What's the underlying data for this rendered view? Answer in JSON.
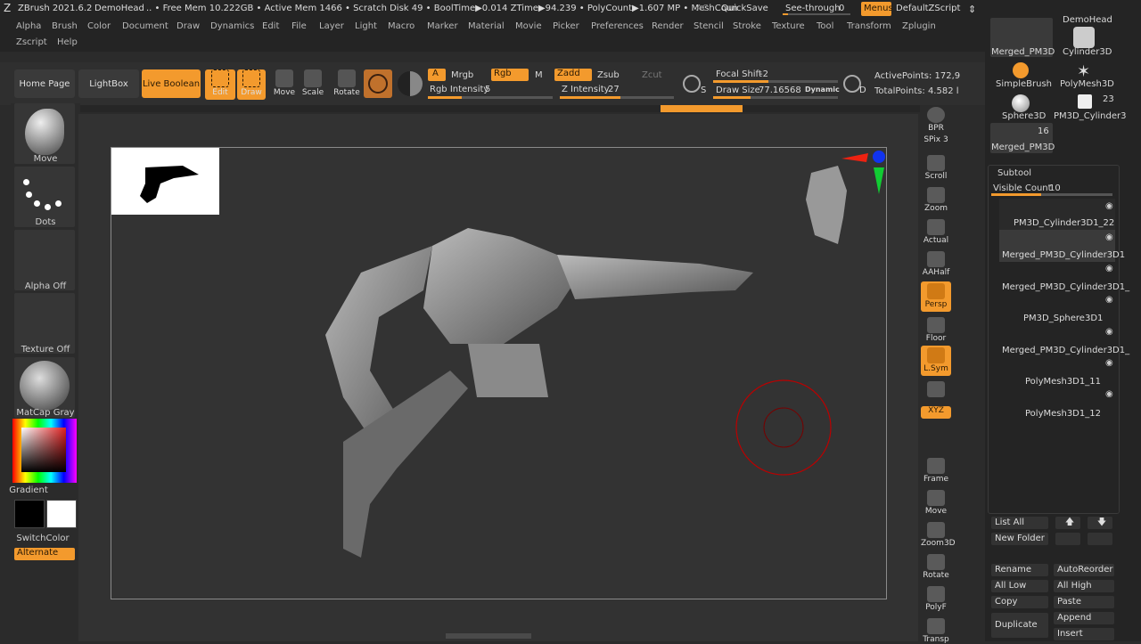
{
  "titlebar": {
    "app": "ZBrush 2021.6.2",
    "project": "DemoHead",
    "stats": ".. • Free Mem 10.222GB • Active Mem 1466 • Scratch Disk 49 • BoolTime▶0.014 ZTime▶94.239 • PolyCount▶1.607 MP • MeshCoun",
    "ac": "AC",
    "quicksave": "QuickSave",
    "seethrough_label": "See-through",
    "seethrough_value": "0",
    "menus": "Menus",
    "script": "DefaultZScript"
  },
  "menu": {
    "row1": [
      "Alpha",
      "Brush",
      "Color",
      "Document",
      "Draw",
      "Dynamics",
      "Edit",
      "File",
      "Layer",
      "Light",
      "Macro",
      "Marker",
      "Material",
      "Movie",
      "Picker",
      "Preferences",
      "Render",
      "Stencil",
      "Stroke",
      "Texture",
      "Tool",
      "Transform",
      "Zplugin"
    ],
    "row2": [
      "Zscript",
      "Help"
    ]
  },
  "toolbar": {
    "home": "Home Page",
    "lightbox": "LightBox",
    "liveboolean": "Live Boolean",
    "edit": "Edit",
    "draw": "Draw",
    "move": "Move",
    "scale": "Scale",
    "rotate": "Rotate",
    "a": "A",
    "mrgb": "Mrgb",
    "rgb": "Rgb",
    "m": "M",
    "zadd": "Zadd",
    "zsub": "Zsub",
    "zcut": "Zcut",
    "rgb_intensity_label": "Rgb Intensity",
    "rgb_intensity": "5",
    "z_intensity_label": "Z Intensity",
    "z_intensity": "27",
    "focal_label": "Focal Shift",
    "focal": "-2",
    "drawsize_label": "Draw Size",
    "drawsize": "77.16568",
    "dynamic": "Dynamic",
    "s": "S",
    "d": "D",
    "active_points": "ActivePoints: 172,9",
    "total_points": "TotalPoints: 4.582 l"
  },
  "left": {
    "move": "Move",
    "dots": "Dots",
    "alpha": "Alpha Off",
    "texture": "Texture Off",
    "matcap": "MatCap Gray",
    "gradient": "Gradient",
    "switchcolor": "SwitchColor",
    "alternate": "Alternate"
  },
  "right": [
    "BPR",
    "SPix 3",
    "Scroll",
    "Zoom",
    "Actual",
    "AAHalf",
    "Persp",
    "Floor",
    "L.Sym",
    "",
    "XYZ",
    "",
    "",
    "Frame",
    "Move",
    "Zoom3D",
    "Rotate",
    "PolyF",
    "Transp"
  ],
  "tools": [
    {
      "name": "Merged_PM3D"
    },
    {
      "name": "Cylinder3D"
    },
    {
      "name": "SimpleBrush"
    },
    {
      "name": "PolyMesh3D"
    },
    {
      "name": "Sphere3D"
    },
    {
      "name": "PM3D_Cylinder3"
    }
  ],
  "tool_counts": {
    "c1": "23",
    "c2": "16"
  },
  "tool_header": "DemoHead",
  "subtool": {
    "title": "Subtool",
    "visible_label": "Visible Count",
    "visible_value": "10",
    "items": [
      "PM3D_Cylinder3D1_22",
      "Merged_PM3D_Cylinder3D1",
      "Merged_PM3D_Cylinder3D1_",
      "PM3D_Sphere3D1",
      "Merged_PM3D_Cylinder3D1_",
      "PolyMesh3D1_11",
      "PolyMesh3D1_12"
    ]
  },
  "panel_buttons": {
    "listall": "List All",
    "newfolder": "New Folder",
    "rename": "Rename",
    "autoreorder": "AutoReorder",
    "alllow": "All Low",
    "allhigh": "All High",
    "copy": "Copy",
    "paste": "Paste",
    "duplicate": "Duplicate",
    "append": "Append",
    "insert": "Insert"
  },
  "colors": {
    "accent": "#f39a2d",
    "bg": "#2b2b2b"
  }
}
